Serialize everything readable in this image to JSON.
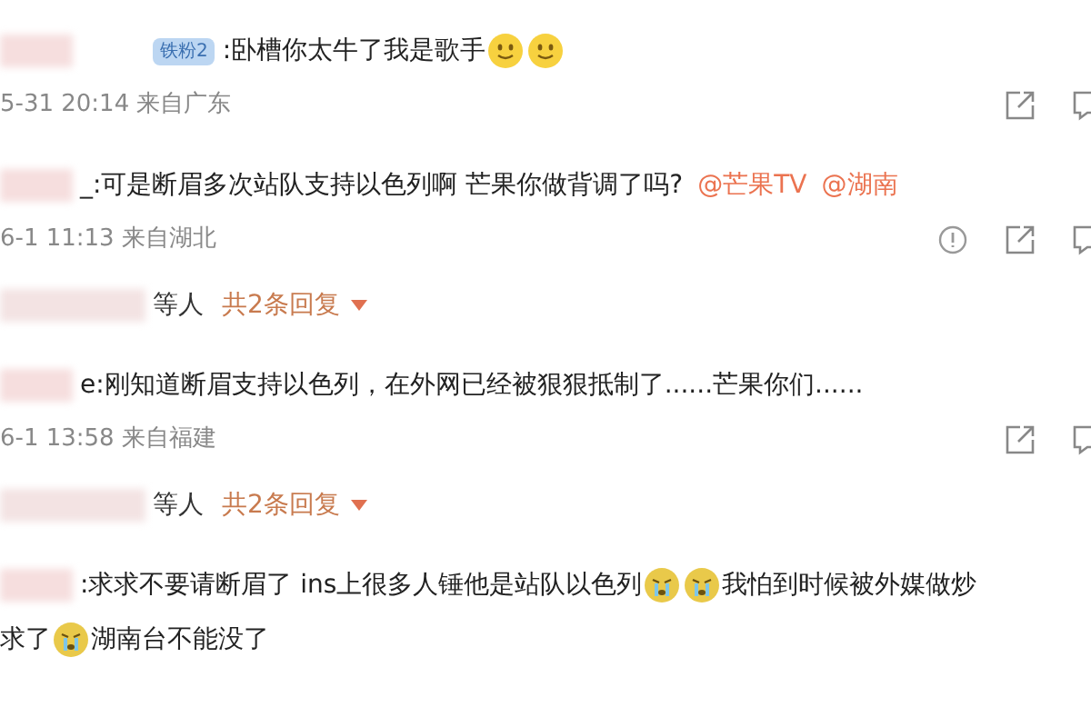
{
  "comments": [
    {
      "badge": "铁粉2",
      "content": [
        {
          "kind": "text",
          "text": ":卧槽你太牛了我是歌手"
        },
        {
          "kind": "smile"
        },
        {
          "kind": "smile"
        }
      ],
      "time": "5-31 20:14 来自广东",
      "actions": [
        {
          "kind": "share"
        },
        {
          "kind": "comment"
        }
      ]
    },
    {
      "content": [
        {
          "kind": "text",
          "text": "_:可是断眉多次站队支持以色列啊 芒果你做背调了吗?"
        },
        {
          "kind": "mention",
          "text": "@芒果TV"
        },
        {
          "kind": "mention",
          "text": "@湖南"
        }
      ],
      "time": "6-1 11:13 来自湖北",
      "actions": [
        {
          "kind": "report"
        },
        {
          "kind": "share"
        },
        {
          "kind": "comment"
        }
      ],
      "replies": {
        "who": "等人",
        "count": "共2条回复"
      }
    },
    {
      "content": [
        {
          "kind": "text",
          "text": "e:刚知道断眉支持以色列，在外网已经被狠狠抵制了......芒果你们......"
        }
      ],
      "time": "6-1 13:58 来自福建",
      "actions": [
        {
          "kind": "share"
        },
        {
          "kind": "comment"
        }
      ],
      "replies": {
        "who": "等人",
        "count": "共2条回复"
      }
    },
    {
      "content": [
        {
          "kind": "text",
          "text": ":求求不要请断眉了 ins上很多人锤他是站队以色列"
        },
        {
          "kind": "cry"
        },
        {
          "kind": "cry"
        },
        {
          "kind": "text",
          "text": "我怕到时候被外媒做炒"
        }
      ],
      "second_line": [
        {
          "kind": "text",
          "text": "求了"
        },
        {
          "kind": "cry"
        },
        {
          "kind": "text",
          "text": "湖南台不能没了"
        }
      ]
    }
  ]
}
